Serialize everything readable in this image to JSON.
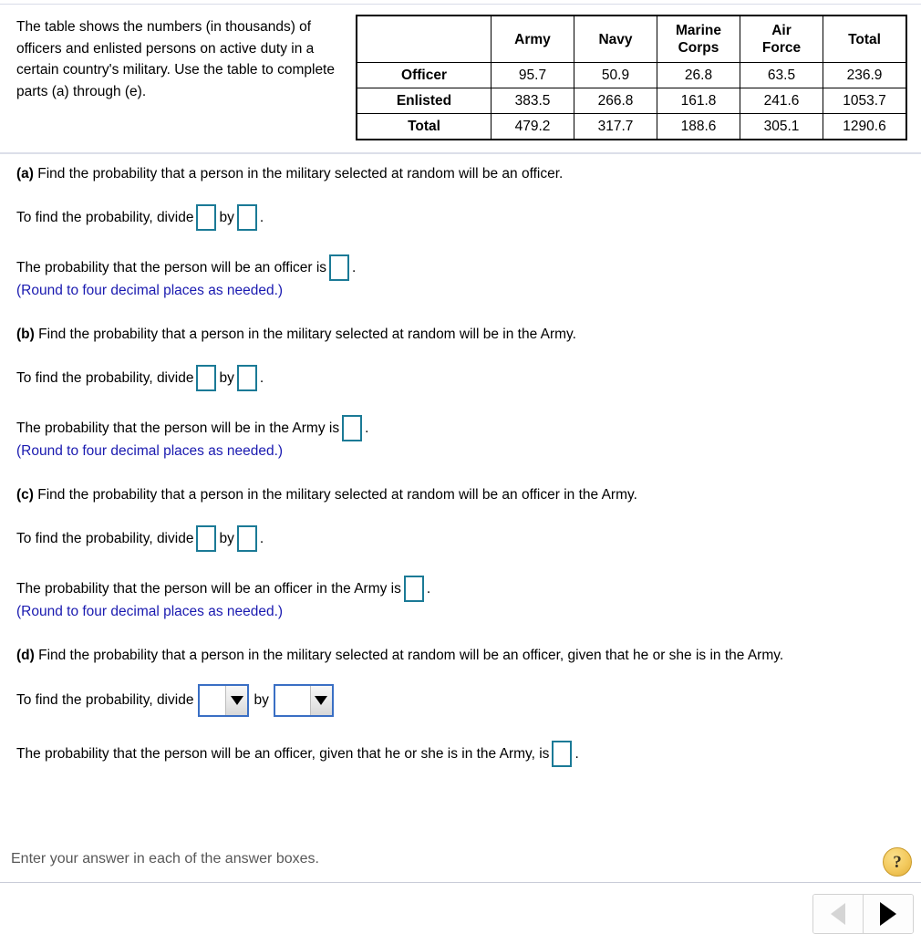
{
  "problem": {
    "intro": "The table shows the numbers (in thousands) of officers and enlisted persons on active duty in a certain country's military. Use the table to complete parts (a) through (e).",
    "table": {
      "corner_header": "",
      "column_headers": [
        "Army",
        "Navy",
        "Marine Corps",
        "Air Force",
        "Total"
      ],
      "column_headers_lines": [
        [
          "Army"
        ],
        [
          "Navy"
        ],
        [
          "Marine",
          "Corps"
        ],
        [
          "Air",
          "Force"
        ],
        [
          "Total"
        ]
      ],
      "rows": [
        {
          "label": "Officer",
          "values": [
            "95.7",
            "50.9",
            "26.8",
            "63.5",
            "236.9"
          ]
        },
        {
          "label": "Enlisted",
          "values": [
            "383.5",
            "266.8",
            "161.8",
            "241.6",
            "1053.7"
          ]
        },
        {
          "label": "Total",
          "values": [
            "479.2",
            "317.7",
            "188.6",
            "305.1",
            "1290.6"
          ]
        }
      ]
    }
  },
  "parts": {
    "a": {
      "label": "(a)",
      "question": " Find the probability that a person in the military selected at random will be an officer.",
      "work_prefix": "To find the probability, divide",
      "work_middle": "by",
      "work_suffix": ".",
      "answer_prefix": "The probability that the person will be an officer is",
      "answer_suffix": ".",
      "note": "(Round to four decimal places as needed.)",
      "numerator_value": "",
      "denominator_value": "",
      "result_value": ""
    },
    "b": {
      "label": "(b)",
      "question": " Find the probability that a person in the military selected at random will be in the Army.",
      "work_prefix": "To find the probability, divide",
      "work_middle": "by",
      "work_suffix": ".",
      "answer_prefix": "The probability that the person will be in the Army is",
      "answer_suffix": ".",
      "note": "(Round to four decimal places as needed.)",
      "numerator_value": "",
      "denominator_value": "",
      "result_value": ""
    },
    "c": {
      "label": "(c)",
      "question": " Find the probability that a person in the military selected at random will be an officer in the Army.",
      "work_prefix": "To find the probability, divide",
      "work_middle": "by",
      "work_suffix": ".",
      "answer_prefix": "The probability that the person will be an officer in the Army is",
      "answer_suffix": ".",
      "note": "(Round to four decimal places as needed.)",
      "numerator_value": "",
      "denominator_value": "",
      "result_value": ""
    },
    "d": {
      "label": "(d)",
      "question": " Find the probability that a person in the military selected at random will be an officer, given that he or she is in the Army.",
      "work_prefix": "To find the probability, divide",
      "work_middle": "by",
      "work_suffix": "",
      "answer_prefix": "The probability that the person will be an officer, given that he or she is in the Army, is",
      "answer_suffix": ".",
      "numerator_selected": "",
      "denominator_selected": "",
      "result_value": ""
    }
  },
  "status": {
    "message": "Enter your answer in each of the answer boxes.",
    "help_glyph": "?"
  },
  "nav": {
    "previous_label": "",
    "next_label": ""
  },
  "colors": {
    "answer_box_border": "#1b7a96",
    "dropdown_border": "#3a6fc4",
    "note_text": "#1a1ab0",
    "help_button": "#f3c95d",
    "status_text": "#585858"
  }
}
